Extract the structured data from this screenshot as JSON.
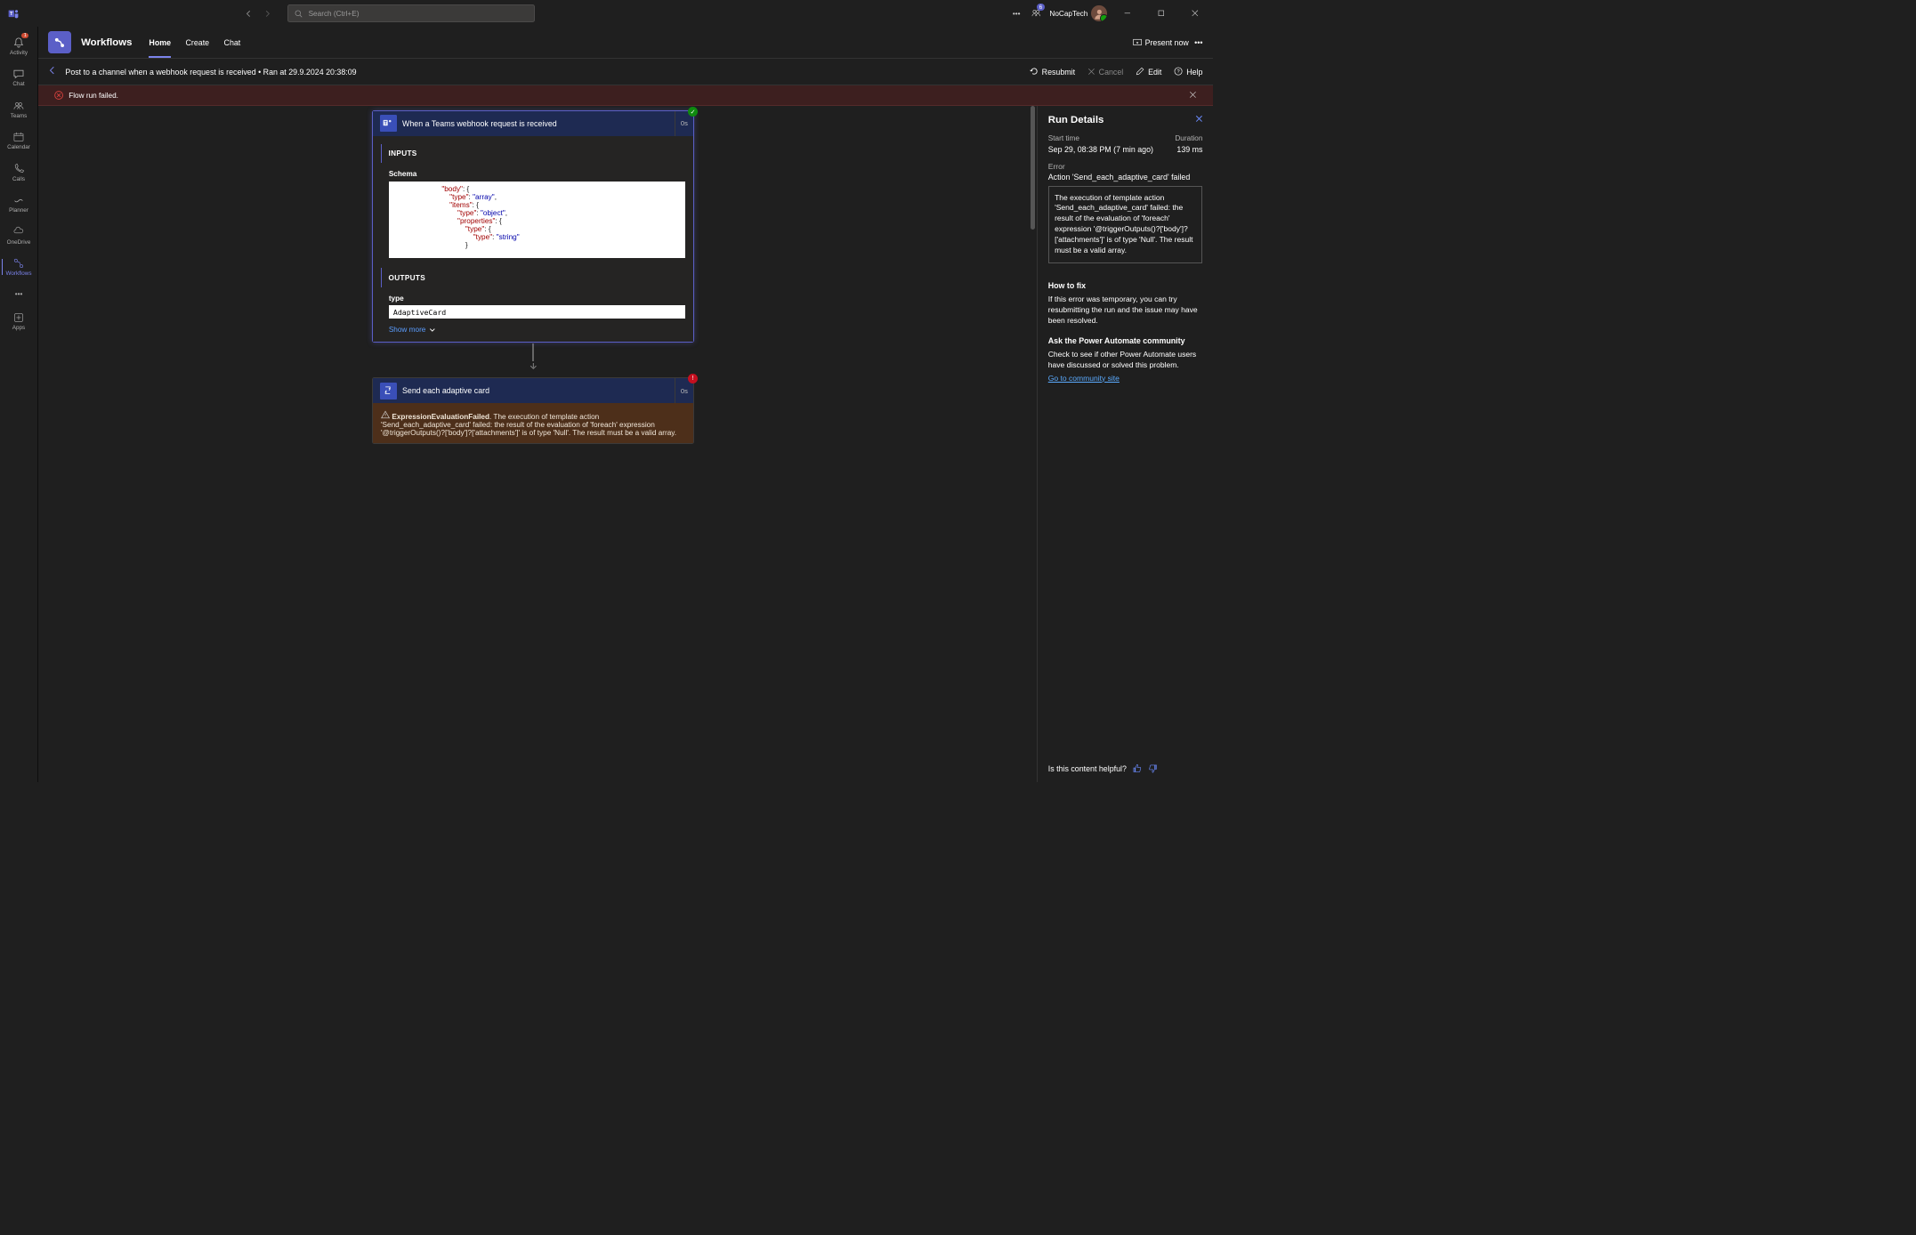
{
  "titlebar": {
    "search_placeholder": "Search (Ctrl+E)",
    "notif_count": "6",
    "user_name": "NoCapTech"
  },
  "rail": {
    "items": [
      {
        "label": "Activity",
        "badge": "1"
      },
      {
        "label": "Chat"
      },
      {
        "label": "Teams"
      },
      {
        "label": "Calendar"
      },
      {
        "label": "Calls"
      },
      {
        "label": "Planner"
      },
      {
        "label": "OneDrive"
      },
      {
        "label": "Workflows"
      },
      {
        "label": ""
      },
      {
        "label": "Apps"
      }
    ]
  },
  "workflows": {
    "title": "Workflows",
    "tabs": [
      "Home",
      "Create",
      "Chat"
    ],
    "present": "Present now"
  },
  "subheader": {
    "text": "Post to a channel when a webhook request is received • Ran at 29.9.2024 20:38:09",
    "resubmit": "Resubmit",
    "cancel": "Cancel",
    "edit": "Edit",
    "help": "Help"
  },
  "banner": {
    "text": "Flow run failed."
  },
  "canvas": {
    "card1": {
      "title": "When a Teams webhook request is received",
      "time": "0s",
      "inputs_label": "INPUTS",
      "schema_label": "Schema",
      "outputs_label": "OUTPUTS",
      "output_type_key": "type",
      "output_type_val": "AdaptiveCard",
      "show_more": "Show more"
    },
    "card2": {
      "title": "Send each adaptive card",
      "time": "0s",
      "error_title": "ExpressionEvaluationFailed",
      "error_body": ". The execution of template action 'Send_each_adaptive_card' failed: the result of the evaluation of 'foreach' expression '@triggerOutputs()?['body']?['attachments']' is of type 'Null'. The result must be a valid array."
    }
  },
  "panel": {
    "title": "Run Details",
    "start_label": "Start time",
    "duration_label": "Duration",
    "start_val": "Sep 29, 08:38 PM (7 min ago)",
    "duration_val": "139 ms",
    "error_label": "Error",
    "error_summary": "Action 'Send_each_adaptive_card' failed",
    "error_detail": "The execution of template action 'Send_each_adaptive_card' failed: the result of the evaluation of 'foreach' expression '@triggerOutputs()?['body']?['attachments']' is of type 'Null'. The result must be a valid array.",
    "fix_title": "How to fix",
    "fix_body": "If this error was temporary, you can try resubmitting the run and the issue may have been resolved.",
    "community_title": "Ask the Power Automate community",
    "community_body": "Check to see if other Power Automate users have discussed or solved this problem.",
    "community_link": "Go to community site",
    "helpful": "Is this content helpful?"
  }
}
